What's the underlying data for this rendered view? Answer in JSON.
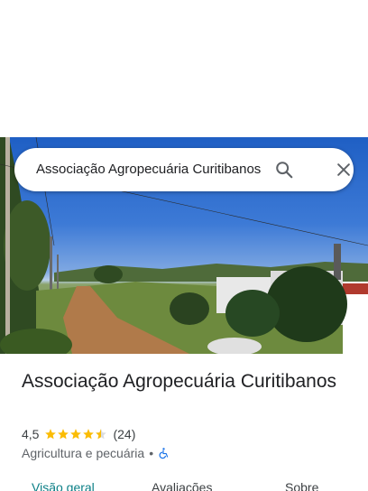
{
  "search": {
    "query": "Associação Agropecuária Curitibanos",
    "search_icon": "search-icon",
    "close_icon": "close-icon"
  },
  "place": {
    "name": "Associação Agropecuária Curitibanos",
    "rating": "4,5",
    "stars_value": 4.5,
    "reviews": "(24)",
    "category": "Agricultura e pecuária",
    "separator": "•",
    "accessibility_icon": "wheelchair-icon"
  },
  "tabs": [
    {
      "label": "Visão geral",
      "active": true
    },
    {
      "label": "Avaliações",
      "active": false
    },
    {
      "label": "Sobre",
      "active": false
    }
  ],
  "colors": {
    "accent": "#0b7f86",
    "star": "#fbbc04",
    "accessibility": "#1a73e8"
  }
}
